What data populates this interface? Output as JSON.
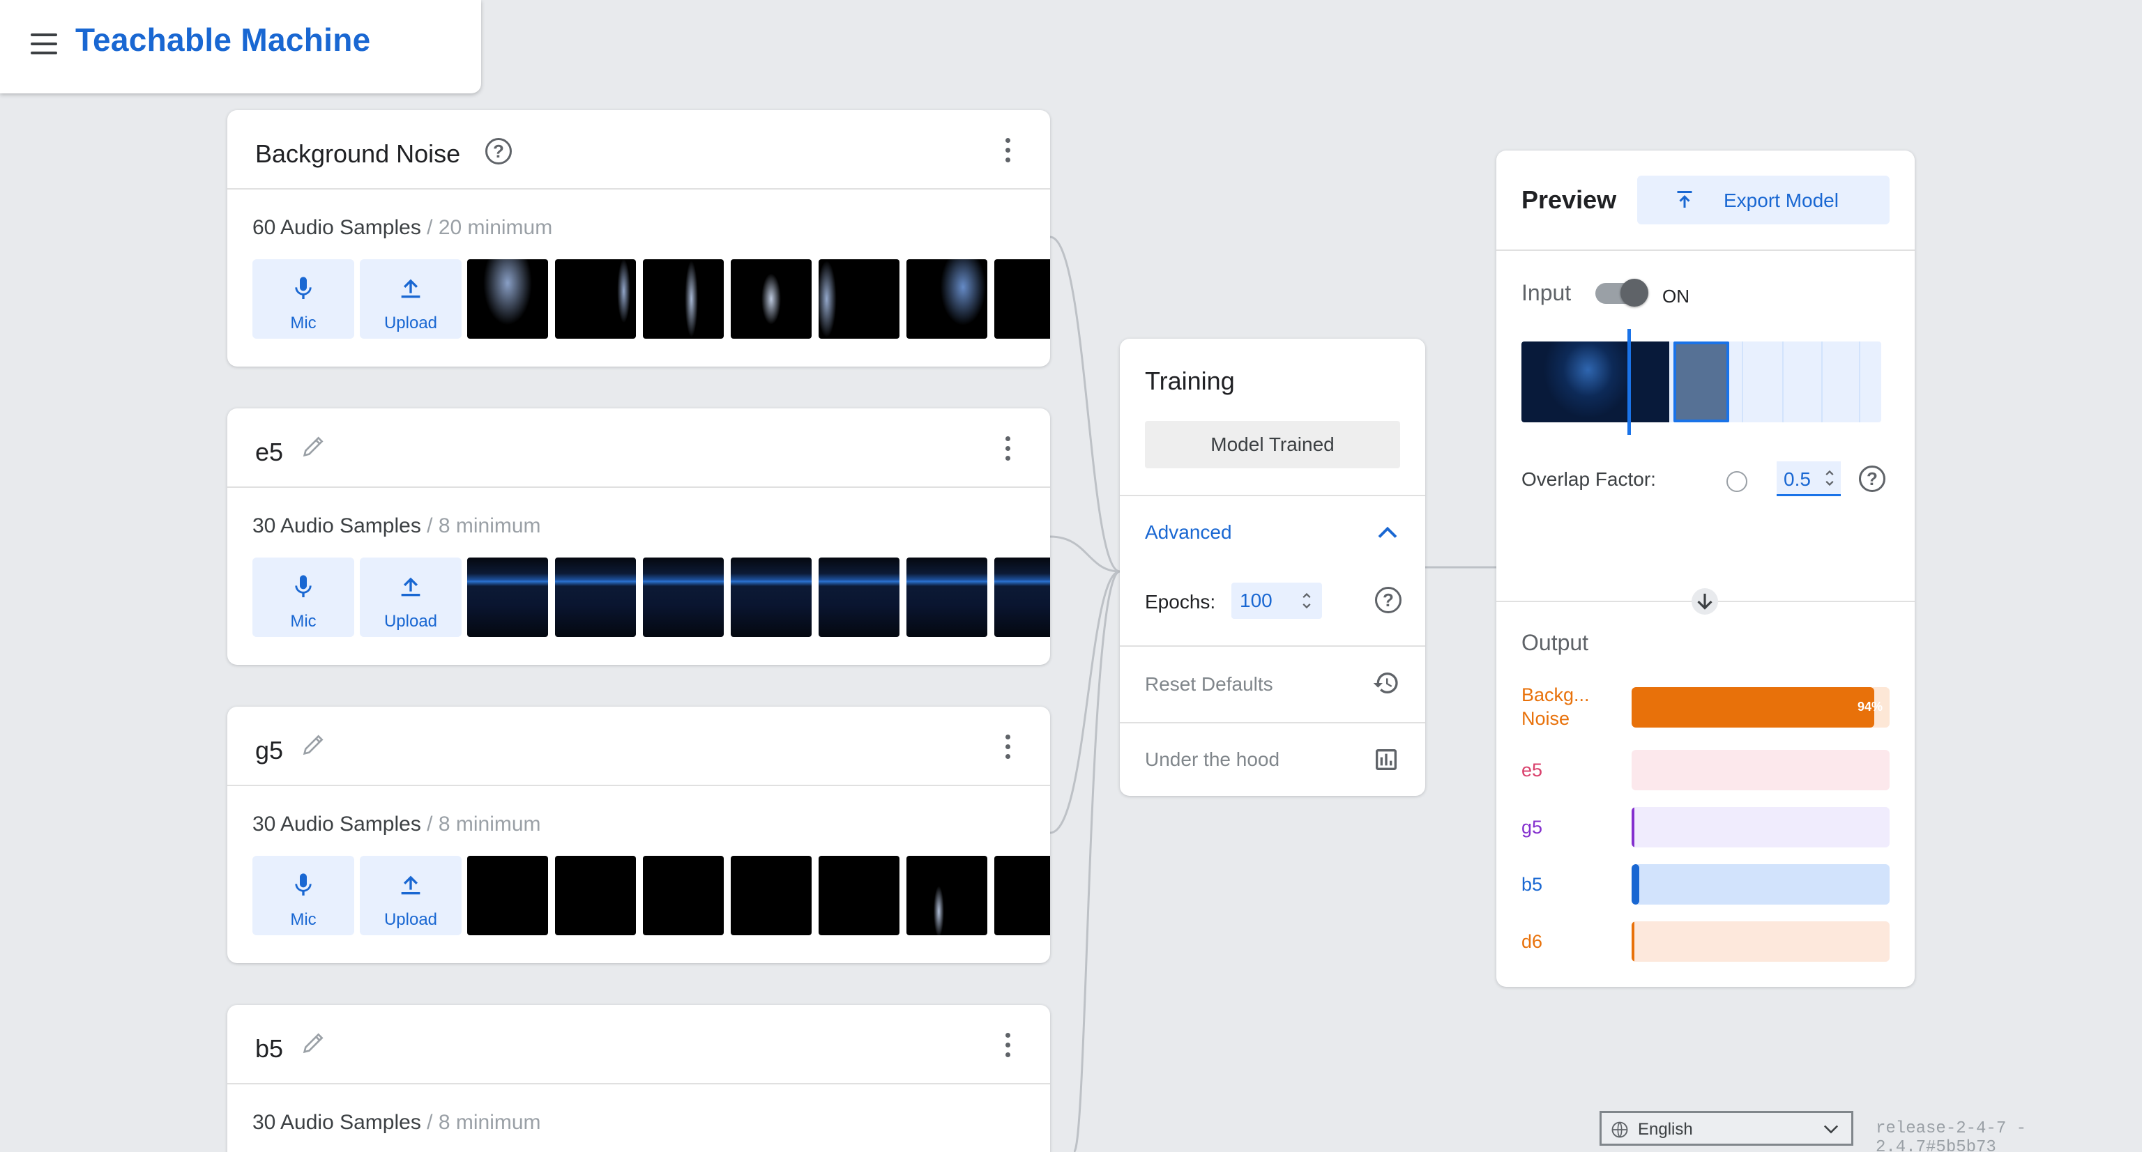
{
  "app": {
    "title": "Teachable Machine"
  },
  "classes": [
    {
      "name": "Background Noise",
      "count_text": "60 Audio Samples",
      "min_text": " / 20 minimum",
      "mic_label": "Mic",
      "upload_label": "Upload"
    },
    {
      "name": "e5",
      "count_text": "30 Audio Samples",
      "min_text": " / 8 minimum",
      "mic_label": "Mic",
      "upload_label": "Upload"
    },
    {
      "name": "g5",
      "count_text": "30 Audio Samples",
      "min_text": " / 8 minimum",
      "mic_label": "Mic",
      "upload_label": "Upload"
    },
    {
      "name": "b5",
      "count_text": "30 Audio Samples",
      "min_text": " / 8 minimum"
    }
  ],
  "training": {
    "title": "Training",
    "status_button": "Model Trained",
    "advanced_label": "Advanced",
    "epochs_label": "Epochs:",
    "epochs_value": "100",
    "reset_label": "Reset Defaults",
    "hood_label": "Under the hood"
  },
  "preview": {
    "title": "Preview",
    "export_label": "Export Model",
    "input_label": "Input",
    "input_state": "ON",
    "overlap_label": "Overlap Factor:",
    "overlap_value": "0.5",
    "output_label": "Output",
    "outputs": [
      {
        "label": "Backg...\nNoise",
        "label_line1": "Backg...",
        "label_line2": "Noise",
        "value": 0.94,
        "pct_text": "94%",
        "color": "#e8710a",
        "track": "#fde7d6"
      },
      {
        "label": "e5",
        "value": 0.0,
        "color": "#d93f6b",
        "track": "#fce8ec"
      },
      {
        "label": "g5",
        "value": 0.01,
        "color": "#8430ce",
        "track": "#f0ecfd"
      },
      {
        "label": "b5",
        "value": 0.03,
        "color": "#1967d2",
        "track": "#d2e3fc"
      },
      {
        "label": "d6",
        "value": 0.01,
        "color": "#e8710a",
        "track": "#fde8dc"
      }
    ]
  },
  "footer": {
    "language": "English",
    "release": "release-2-4-7 - 2.4.7#5b5b73"
  }
}
